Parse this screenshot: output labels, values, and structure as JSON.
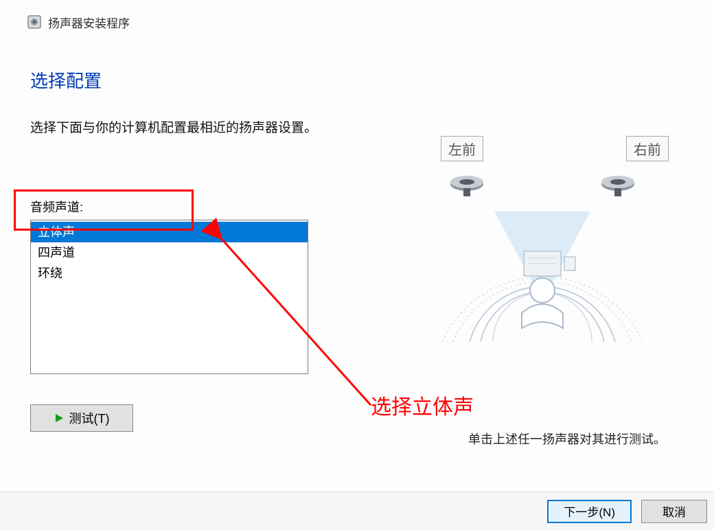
{
  "titlebar": {
    "title": "扬声器安装程序"
  },
  "heading": "选择配置",
  "instruction": "选择下面与你的计算机配置最相近的扬声器设置。",
  "channel_label": "音频声道:",
  "channel_options": {
    "0": "立体声",
    "1": "四声道",
    "2": "环绕"
  },
  "test_button": "测试(T)",
  "speaker_labels": {
    "left": "左前",
    "right": "右前"
  },
  "speaker_hint": "单击上述任一扬声器对其进行测试。",
  "annotation": "选择立体声",
  "footer": {
    "next": "下一步(N)",
    "cancel": "取消"
  }
}
